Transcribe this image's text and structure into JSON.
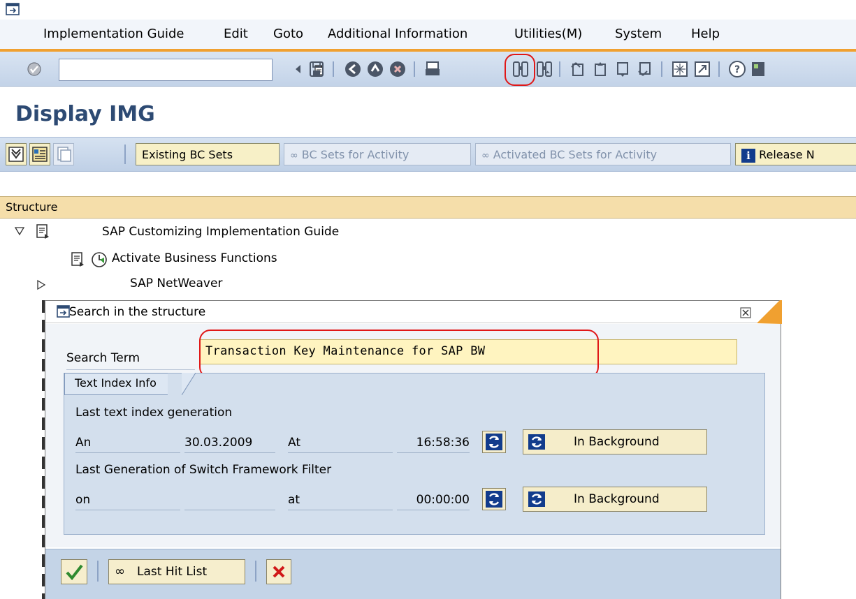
{
  "menu": {
    "items": [
      {
        "label": "Implementation Guide"
      },
      {
        "label": "Edit"
      },
      {
        "label": "Goto"
      },
      {
        "label": "Additional Information"
      },
      {
        "label": "Utilities(M)"
      },
      {
        "label": "System"
      },
      {
        "label": "Help"
      }
    ]
  },
  "system_toolbar": {
    "command_value": "",
    "icons": [
      "enter-icon",
      "back-icon",
      "save-icon",
      "back-arrow-icon",
      "exit-icon",
      "cancel-icon",
      "print-icon",
      "find-icon",
      "find-next-icon",
      "first-page-icon",
      "previous-page-icon",
      "next-page-icon",
      "last-page-icon",
      "create-session-icon",
      "shortcut-icon",
      "help-icon",
      "layout-icon"
    ]
  },
  "page": {
    "title": "Display IMG"
  },
  "app_toolbar": {
    "existing_bc_sets": "Existing BC Sets",
    "bc_sets_for_activity": "BC Sets for Activity",
    "activated_bc_sets": "Activated BC Sets for Activity",
    "release_notes": "Release N"
  },
  "structure": {
    "header": "Structure",
    "rows": [
      {
        "label": "SAP Customizing Implementation Guide"
      },
      {
        "label": "Activate Business Functions"
      },
      {
        "label": "SAP NetWeaver"
      }
    ]
  },
  "dialog": {
    "title": "Search in the structure",
    "search_label": "Search Term",
    "search_value": "Transaction Key Maintenance for SAP BW",
    "group_tab": "Text Index Info",
    "last_text_index_label": "Last text index generation",
    "text_index_on_label": "An",
    "text_index_date": "30.03.2009",
    "text_index_at_label": "At",
    "text_index_time": "16:58:36",
    "last_switch_label": "Last Generation of Switch Framework Filter",
    "switch_on_label": "on",
    "switch_date": "",
    "switch_at_label": "at",
    "switch_time": "00:00:00",
    "background_button": "In Background",
    "last_hit_list": "Last Hit List"
  },
  "colors": {
    "title": "#2d4a73",
    "highlight": "#e01818",
    "structure_header": "#f5deaa",
    "search_field": "#fff4c0"
  }
}
